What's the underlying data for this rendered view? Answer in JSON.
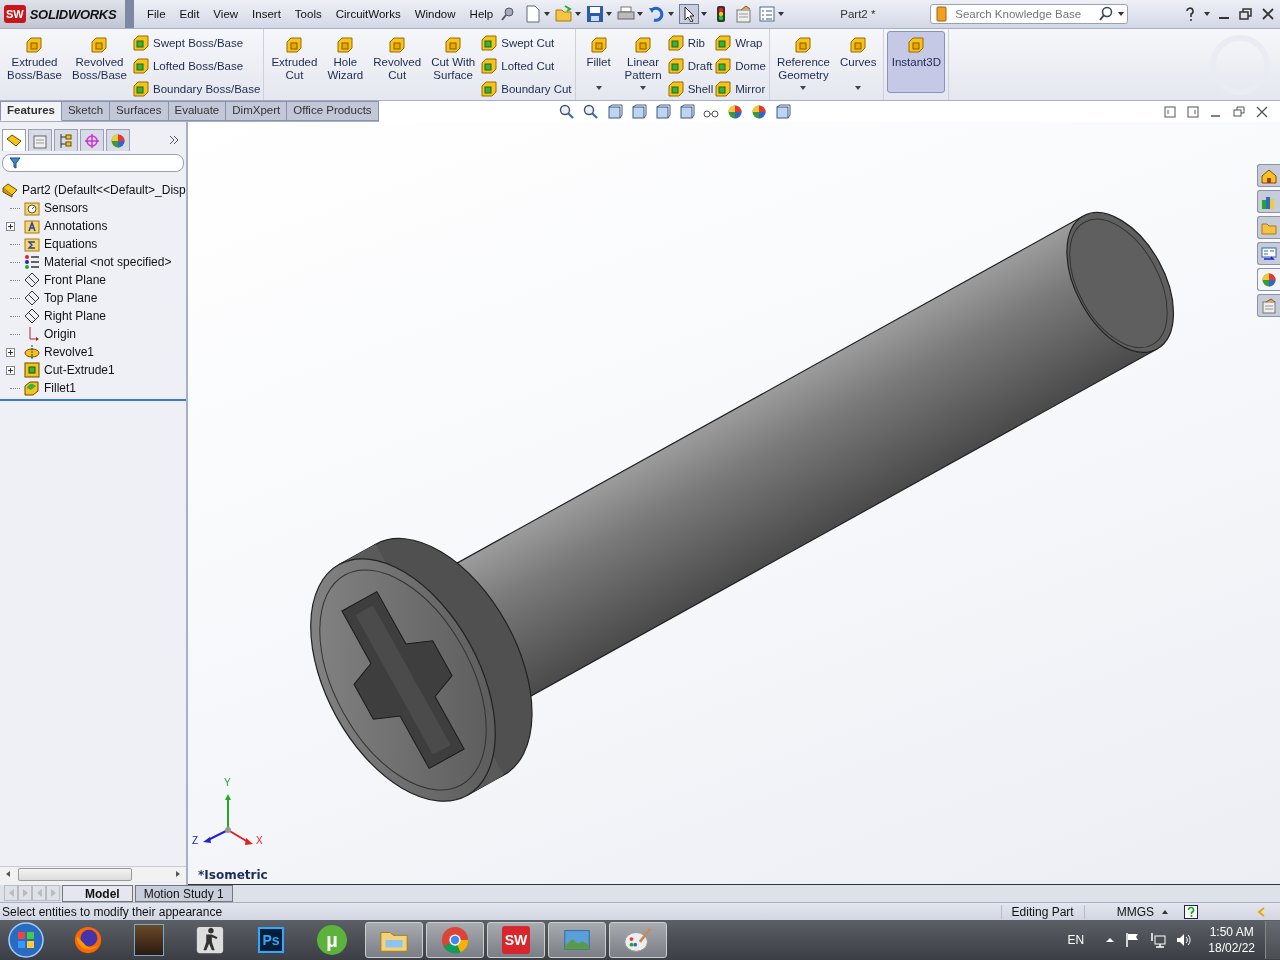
{
  "app": {
    "mark": "SW",
    "name": "SOLIDWORKS"
  },
  "menu": [
    "File",
    "Edit",
    "View",
    "Insert",
    "Tools",
    "CircuitWorks",
    "Window",
    "Help"
  ],
  "document_title": "Part2 *",
  "search": {
    "placeholder": "Search Knowledge Base"
  },
  "ribbon": [
    [
      {
        "kind": "large",
        "label": "Extruded\nBoss/Base",
        "dropdown": false,
        "on": false
      },
      {
        "kind": "large",
        "label": "Revolved\nBoss/Base",
        "dropdown": false,
        "on": false
      },
      {
        "kind": "stack",
        "items": [
          "Swept Boss/Base",
          "Lofted Boss/Base",
          "Boundary Boss/Base"
        ]
      }
    ],
    [
      {
        "kind": "large",
        "label": "Extruded\nCut",
        "dropdown": false,
        "on": false
      },
      {
        "kind": "large",
        "label": "Hole\nWizard",
        "dropdown": false,
        "on": false
      },
      {
        "kind": "large",
        "label": "Revolved\nCut",
        "dropdown": false,
        "on": false
      },
      {
        "kind": "large",
        "label": "Cut With\nSurface",
        "dropdown": false,
        "on": false
      },
      {
        "kind": "stack",
        "items": [
          "Swept Cut",
          "Lofted Cut",
          "Boundary Cut"
        ]
      }
    ],
    [
      {
        "kind": "large",
        "label": "Fillet",
        "dropdown": true,
        "on": false
      },
      {
        "kind": "large",
        "label": "Linear\nPattern",
        "dropdown": true,
        "on": false
      },
      {
        "kind": "stack",
        "items": [
          "Rib",
          "Draft",
          "Shell"
        ]
      },
      {
        "kind": "stack",
        "items": [
          "Wrap",
          "Dome",
          "Mirror"
        ]
      }
    ],
    [
      {
        "kind": "large",
        "label": "Reference\nGeometry",
        "dropdown": true,
        "on": false
      },
      {
        "kind": "large",
        "label": "Curves",
        "dropdown": true,
        "on": false
      }
    ],
    [
      {
        "kind": "large",
        "label": "Instant3D",
        "dropdown": false,
        "on": true
      }
    ]
  ],
  "command_tabs": [
    {
      "label": "Features",
      "selected": true
    },
    {
      "label": "Sketch",
      "selected": false
    },
    {
      "label": "Surfaces",
      "selected": false
    },
    {
      "label": "Evaluate",
      "selected": false
    },
    {
      "label": "DimXpert",
      "selected": false
    },
    {
      "label": "Office Products",
      "selected": false
    }
  ],
  "manager_tabs": [
    {
      "kind": "feature-tree",
      "selected": true
    },
    {
      "kind": "property",
      "selected": false
    },
    {
      "kind": "configuration",
      "selected": false
    },
    {
      "kind": "dimxpert",
      "selected": false
    },
    {
      "kind": "display",
      "selected": false
    }
  ],
  "tree": {
    "root": "Part2  (Default<<Default>_Disp",
    "children": [
      {
        "label": "Sensors",
        "kind": "sensors",
        "collapsed": false
      },
      {
        "label": "Annotations",
        "kind": "annotations",
        "collapsed": true
      },
      {
        "label": "Equations",
        "kind": "equations",
        "collapsed": false
      },
      {
        "label": "Material <not specified>",
        "kind": "material",
        "collapsed": false
      },
      {
        "label": "Front Plane",
        "kind": "plane",
        "collapsed": false
      },
      {
        "label": "Top Plane",
        "kind": "plane",
        "collapsed": false
      },
      {
        "label": "Right Plane",
        "kind": "plane",
        "collapsed": false
      },
      {
        "label": "Origin",
        "kind": "origin",
        "collapsed": false
      },
      {
        "label": "Revolve1",
        "kind": "revolve",
        "collapsed": true
      },
      {
        "label": "Cut-Extrude1",
        "kind": "extrude",
        "collapsed": true
      },
      {
        "label": "Fillet1",
        "kind": "fillet",
        "collapsed": false
      }
    ]
  },
  "viewport": {
    "view_name": "*Isometric",
    "triad": {
      "x": "X",
      "y": "Y",
      "z": "Z"
    }
  },
  "task_pane": [
    {
      "kind": "home",
      "selected": false
    },
    {
      "kind": "library",
      "selected": false
    },
    {
      "kind": "folder",
      "selected": false
    },
    {
      "kind": "palette",
      "selected": false
    },
    {
      "kind": "appearance",
      "selected": true
    },
    {
      "kind": "properties",
      "selected": false
    }
  ],
  "bottom_tabs": [
    {
      "label": "Model",
      "selected": true
    },
    {
      "label": "Motion Study 1",
      "selected": false
    }
  ],
  "status_bar": {
    "message": "Select entities to modify their appearance",
    "mode": "Editing Part",
    "units": "MMGS"
  },
  "taskbar": {
    "items": [
      {
        "kind": "firefox",
        "running": false
      },
      {
        "kind": "game",
        "running": false
      },
      {
        "kind": "soldier",
        "running": false
      },
      {
        "kind": "ps",
        "label": "Ps",
        "running": false
      },
      {
        "kind": "torrent",
        "label": "µ",
        "running": false
      },
      {
        "kind": "folder",
        "running": true
      },
      {
        "kind": "chrome",
        "running": true
      },
      {
        "kind": "sw",
        "label": "SW",
        "running": true
      },
      {
        "kind": "photos",
        "running": true
      },
      {
        "kind": "paint",
        "running": true
      }
    ],
    "language": "EN",
    "time": "1:50 AM",
    "date": "18/02/22"
  }
}
